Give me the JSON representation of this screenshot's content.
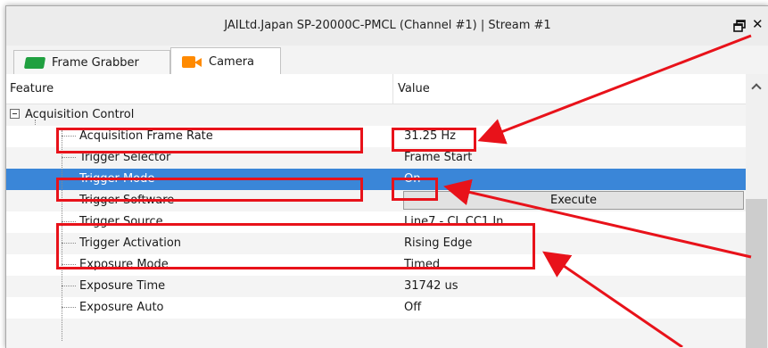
{
  "window": {
    "title": "JAILtd.Japan SP-20000C-PMCL (Channel #1) | Stream #1",
    "restore_icon": "restore-window-icon",
    "close_glyph": "✕"
  },
  "tabs": [
    {
      "label": "Frame Grabber",
      "icon": "frame-grabber-icon"
    },
    {
      "label": "Camera",
      "icon": "camera-icon"
    }
  ],
  "grid": {
    "col_feature": "Feature",
    "col_value": "Value",
    "category": "Acquisition Control",
    "rows": [
      {
        "name": "Acquisition Frame Rate",
        "value": "31.25 Hz"
      },
      {
        "name": "Trigger Selector",
        "value": "Frame Start"
      },
      {
        "name": "Trigger Mode",
        "value": "On",
        "selected": true
      },
      {
        "name": "Trigger Software",
        "value": "Execute",
        "button": true
      },
      {
        "name": "Trigger Source",
        "value": "Line7 - CL CC1 In"
      },
      {
        "name": "Trigger Activation",
        "value": "Rising Edge"
      },
      {
        "name": "Exposure Mode",
        "value": "Timed"
      },
      {
        "name": "Exposure Time",
        "value": "31742 us"
      },
      {
        "name": "Exposure Auto",
        "value": "Off"
      }
    ]
  },
  "colors": {
    "selection": "#3a86d8",
    "annotation": "#e8121a"
  }
}
